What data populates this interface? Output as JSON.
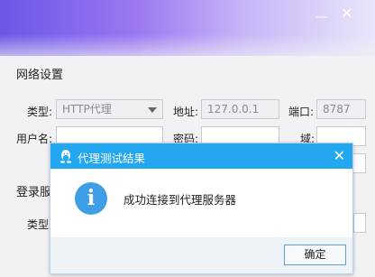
{
  "background": {
    "controls": {
      "minimize": "—",
      "close": "✕"
    },
    "network_section": {
      "title": "网络设置",
      "type_label": "类型:",
      "type_value": "HTTP代理",
      "address_label": "地址:",
      "address_value": "127.0.0.1",
      "port_label": "端口:",
      "port_value": "8787",
      "username_label": "用户名:",
      "password_label": "密码:",
      "domain_label": "域:"
    },
    "login_section": {
      "title_partial": "登录服",
      "type_label_partial": "类型"
    }
  },
  "dialog": {
    "title": "代理测试结果",
    "close_glyph": "✕",
    "icon_glyph": "i",
    "message": "成功连接到代理服务器",
    "ok_label": "确定"
  },
  "colors": {
    "dialog_titlebar": "#22a7f0",
    "info_icon": "#3e9ee6",
    "header_gradient_start": "#6b57e6"
  }
}
